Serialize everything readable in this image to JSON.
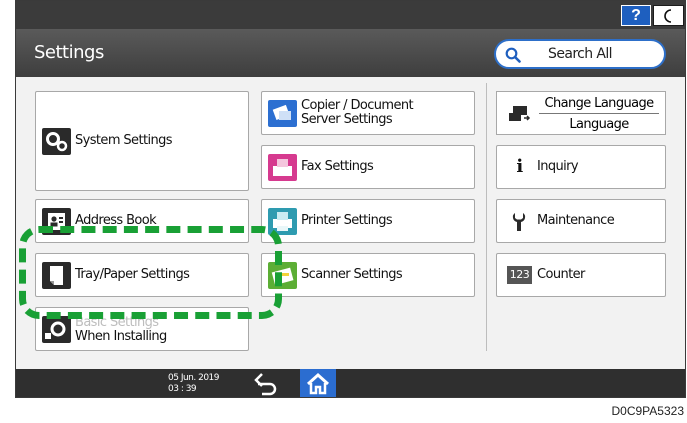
{
  "topbar": {
    "help_label": "?",
    "night_icon": "moon-icon"
  },
  "header": {
    "title": "Settings",
    "search_label": "Search All",
    "search_icon": "magnifier-icon"
  },
  "left_column": [
    {
      "label": "System Settings",
      "icon": "gears-icon"
    },
    {
      "label": "Address Book",
      "icon": "address-book-icon"
    },
    {
      "label": "Tray/Paper Settings",
      "icon": "paper-tray-icon"
    },
    {
      "label_line1": "Basic Settings",
      "label_line2": "When Installing",
      "icon": "gear-setup-icon"
    }
  ],
  "middle_column": [
    {
      "label_line1": "Copier / Document",
      "label_line2": "Server Settings",
      "icon": "copier-icon"
    },
    {
      "label": "Fax Settings",
      "icon": "fax-icon"
    },
    {
      "label": "Printer Settings",
      "icon": "printer-icon"
    },
    {
      "label": "Scanner Settings",
      "icon": "scanner-icon"
    }
  ],
  "right_column": {
    "change_language": {
      "label": "Change Language",
      "sub_label": "Language",
      "icon": "change-language-icon"
    },
    "items": [
      {
        "label": "Inquiry",
        "icon": "info-icon",
        "glyph": "i"
      },
      {
        "label": "Maintenance",
        "icon": "wrench-icon"
      },
      {
        "label": "Counter",
        "icon": "counter-icon",
        "glyph": "123"
      }
    ]
  },
  "statusbar": {
    "date": "05 Jun. 2019",
    "time": "03 : 39",
    "back_icon": "back-arrow-icon",
    "home_icon": "home-icon"
  },
  "caption": "D0C9PA5323",
  "colors": {
    "accent": "#2b6dd0",
    "highlight": "#19a035",
    "header_bg": "#4a4a4a"
  }
}
